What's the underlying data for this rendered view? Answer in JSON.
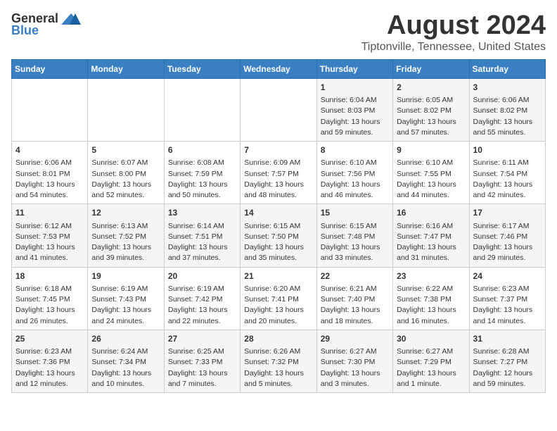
{
  "logo": {
    "general": "General",
    "blue": "Blue"
  },
  "title": "August 2024",
  "subtitle": "Tiptonville, Tennessee, United States",
  "days_of_week": [
    "Sunday",
    "Monday",
    "Tuesday",
    "Wednesday",
    "Thursday",
    "Friday",
    "Saturday"
  ],
  "weeks": [
    [
      {
        "day": "",
        "content": ""
      },
      {
        "day": "",
        "content": ""
      },
      {
        "day": "",
        "content": ""
      },
      {
        "day": "",
        "content": ""
      },
      {
        "day": "1",
        "content": "Sunrise: 6:04 AM\nSunset: 8:03 PM\nDaylight: 13 hours\nand 59 minutes."
      },
      {
        "day": "2",
        "content": "Sunrise: 6:05 AM\nSunset: 8:02 PM\nDaylight: 13 hours\nand 57 minutes."
      },
      {
        "day": "3",
        "content": "Sunrise: 6:06 AM\nSunset: 8:02 PM\nDaylight: 13 hours\nand 55 minutes."
      }
    ],
    [
      {
        "day": "4",
        "content": "Sunrise: 6:06 AM\nSunset: 8:01 PM\nDaylight: 13 hours\nand 54 minutes."
      },
      {
        "day": "5",
        "content": "Sunrise: 6:07 AM\nSunset: 8:00 PM\nDaylight: 13 hours\nand 52 minutes."
      },
      {
        "day": "6",
        "content": "Sunrise: 6:08 AM\nSunset: 7:59 PM\nDaylight: 13 hours\nand 50 minutes."
      },
      {
        "day": "7",
        "content": "Sunrise: 6:09 AM\nSunset: 7:57 PM\nDaylight: 13 hours\nand 48 minutes."
      },
      {
        "day": "8",
        "content": "Sunrise: 6:10 AM\nSunset: 7:56 PM\nDaylight: 13 hours\nand 46 minutes."
      },
      {
        "day": "9",
        "content": "Sunrise: 6:10 AM\nSunset: 7:55 PM\nDaylight: 13 hours\nand 44 minutes."
      },
      {
        "day": "10",
        "content": "Sunrise: 6:11 AM\nSunset: 7:54 PM\nDaylight: 13 hours\nand 42 minutes."
      }
    ],
    [
      {
        "day": "11",
        "content": "Sunrise: 6:12 AM\nSunset: 7:53 PM\nDaylight: 13 hours\nand 41 minutes."
      },
      {
        "day": "12",
        "content": "Sunrise: 6:13 AM\nSunset: 7:52 PM\nDaylight: 13 hours\nand 39 minutes."
      },
      {
        "day": "13",
        "content": "Sunrise: 6:14 AM\nSunset: 7:51 PM\nDaylight: 13 hours\nand 37 minutes."
      },
      {
        "day": "14",
        "content": "Sunrise: 6:15 AM\nSunset: 7:50 PM\nDaylight: 13 hours\nand 35 minutes."
      },
      {
        "day": "15",
        "content": "Sunrise: 6:15 AM\nSunset: 7:48 PM\nDaylight: 13 hours\nand 33 minutes."
      },
      {
        "day": "16",
        "content": "Sunrise: 6:16 AM\nSunset: 7:47 PM\nDaylight: 13 hours\nand 31 minutes."
      },
      {
        "day": "17",
        "content": "Sunrise: 6:17 AM\nSunset: 7:46 PM\nDaylight: 13 hours\nand 29 minutes."
      }
    ],
    [
      {
        "day": "18",
        "content": "Sunrise: 6:18 AM\nSunset: 7:45 PM\nDaylight: 13 hours\nand 26 minutes."
      },
      {
        "day": "19",
        "content": "Sunrise: 6:19 AM\nSunset: 7:43 PM\nDaylight: 13 hours\nand 24 minutes."
      },
      {
        "day": "20",
        "content": "Sunrise: 6:19 AM\nSunset: 7:42 PM\nDaylight: 13 hours\nand 22 minutes."
      },
      {
        "day": "21",
        "content": "Sunrise: 6:20 AM\nSunset: 7:41 PM\nDaylight: 13 hours\nand 20 minutes."
      },
      {
        "day": "22",
        "content": "Sunrise: 6:21 AM\nSunset: 7:40 PM\nDaylight: 13 hours\nand 18 minutes."
      },
      {
        "day": "23",
        "content": "Sunrise: 6:22 AM\nSunset: 7:38 PM\nDaylight: 13 hours\nand 16 minutes."
      },
      {
        "day": "24",
        "content": "Sunrise: 6:23 AM\nSunset: 7:37 PM\nDaylight: 13 hours\nand 14 minutes."
      }
    ],
    [
      {
        "day": "25",
        "content": "Sunrise: 6:23 AM\nSunset: 7:36 PM\nDaylight: 13 hours\nand 12 minutes."
      },
      {
        "day": "26",
        "content": "Sunrise: 6:24 AM\nSunset: 7:34 PM\nDaylight: 13 hours\nand 10 minutes."
      },
      {
        "day": "27",
        "content": "Sunrise: 6:25 AM\nSunset: 7:33 PM\nDaylight: 13 hours\nand 7 minutes."
      },
      {
        "day": "28",
        "content": "Sunrise: 6:26 AM\nSunset: 7:32 PM\nDaylight: 13 hours\nand 5 minutes."
      },
      {
        "day": "29",
        "content": "Sunrise: 6:27 AM\nSunset: 7:30 PM\nDaylight: 13 hours\nand 3 minutes."
      },
      {
        "day": "30",
        "content": "Sunrise: 6:27 AM\nSunset: 7:29 PM\nDaylight: 13 hours\nand 1 minute."
      },
      {
        "day": "31",
        "content": "Sunrise: 6:28 AM\nSunset: 7:27 PM\nDaylight: 12 hours\nand 59 minutes."
      }
    ]
  ]
}
